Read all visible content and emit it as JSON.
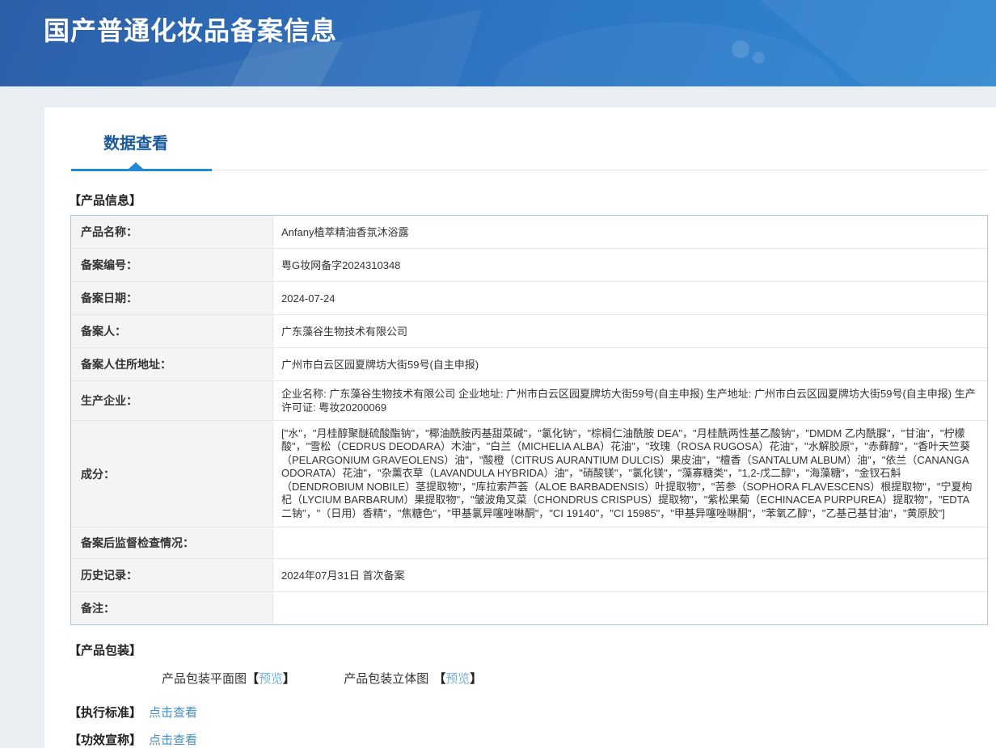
{
  "header": {
    "title": "国产普通化妆品备案信息"
  },
  "tabs": {
    "data_view": "数据查看"
  },
  "product_info": {
    "section_title": "【产品信息】",
    "rows": [
      {
        "label": "产品名称：",
        "value": "Anfany植萃精油香氛沐浴露"
      },
      {
        "label": "备案编号：",
        "value": "粤G妆网备字2024310348"
      },
      {
        "label": "备案日期：",
        "value": "2024-07-24"
      },
      {
        "label": "备案人：",
        "value": "广东藻谷生物技术有限公司"
      },
      {
        "label": "备案人住所地址：",
        "value": "广州市白云区园夏牌坊大街59号(自主申报)"
      },
      {
        "label": "生产企业：",
        "value": "企业名称: 广东藻谷生物技术有限公司 企业地址: 广州市白云区园夏牌坊大街59号(自主申报) 生产地址: 广州市白云区园夏牌坊大街59号(自主申报) 生产许可证: 粤妆20200069"
      },
      {
        "label": "成分：",
        "value": "[\"水\"，\"月桂醇聚醚硫酸酯钠\"，\"椰油酰胺丙基甜菜碱\"，\"氯化钠\"，\"棕榈仁油酰胺 DEA\"，\"月桂酰两性基乙酸钠\"，\"DMDM 乙内酰脲\"，\"甘油\"，\"柠檬酸\"，\"雪松（CEDRUS DEODARA）木油\"，\"白兰（MICHELIA ALBA）花油\"，\"玫瑰（ROSA RUGOSA）花油\"，\"水解胶原\"，\"赤藓醇\"，\"香叶天竺葵（PELARGONIUM GRAVEOLENS）油\"，\"酸橙（CITRUS AURANTIUM DULCIS）果皮油\"，\"檀香（SANTALUM ALBUM）油\"，\"依兰（CANANGA ODORATA）花油\"，\"杂薰衣草（LAVANDULA HYBRIDA）油\"，\"硝酸镁\"，\"氯化镁\"，\"藻寡糖类\"，\"1,2-戊二醇\"，\"海藻糖\"，\"金钗石斛（DENDROBIUM NOBILE）茎提取物\"，\"库拉索芦荟（ALOE BARBADENSIS）叶提取物\"，\"苦参（SOPHORA FLAVESCENS）根提取物\"，\"宁夏枸杞（LYCIUM BARBARUM）果提取物\"，\"皱波角叉菜（CHONDRUS CRISPUS）提取物\"，\"紫松果菊（ECHINACEA PURPUREA）提取物\"，\"EDTA 二钠\"，\"（日用）香精\"，\"焦糖色\"，\"甲基氯异噻唑啉酮\"，\"CI 19140\"，\"CI 15985\"，\"甲基异噻唑啉酮\"，\"苯氧乙醇\"，\"乙基己基甘油\"，\"黄原胶\"]"
      },
      {
        "label": "备案后监督检查情况：",
        "value": ""
      },
      {
        "label": "历史记录：",
        "value": "2024年07月31日 首次备案"
      },
      {
        "label": "备注：",
        "value": ""
      }
    ]
  },
  "packaging": {
    "section_title": "【产品包装】",
    "items": [
      {
        "label": "产品包装平面图",
        "bracket_open": "【",
        "link": "预览",
        "bracket_close": "】"
      },
      {
        "label": "产品包装立体图",
        "bracket_open": "【",
        "link": "预览",
        "bracket_close": "】"
      }
    ]
  },
  "standard": {
    "title": "【执行标准】",
    "link": "点击查看"
  },
  "efficacy": {
    "title": "【功效宣称】",
    "link": "点击查看"
  },
  "colors": {
    "header_gradient_start": "#2d5fa8",
    "header_gradient_end": "#3087d3",
    "tab_active_text": "#1a5a9e",
    "tab_underline_blue": "#2288d8",
    "table_outer_border": "#a9c7e4",
    "table_inner_border": "#e6e6e6",
    "label_cell_bg": "#f4f4f4",
    "body_bg": "#e9eef3",
    "link_preview": "#74b1e0",
    "link_click": "#3f8fd4"
  }
}
